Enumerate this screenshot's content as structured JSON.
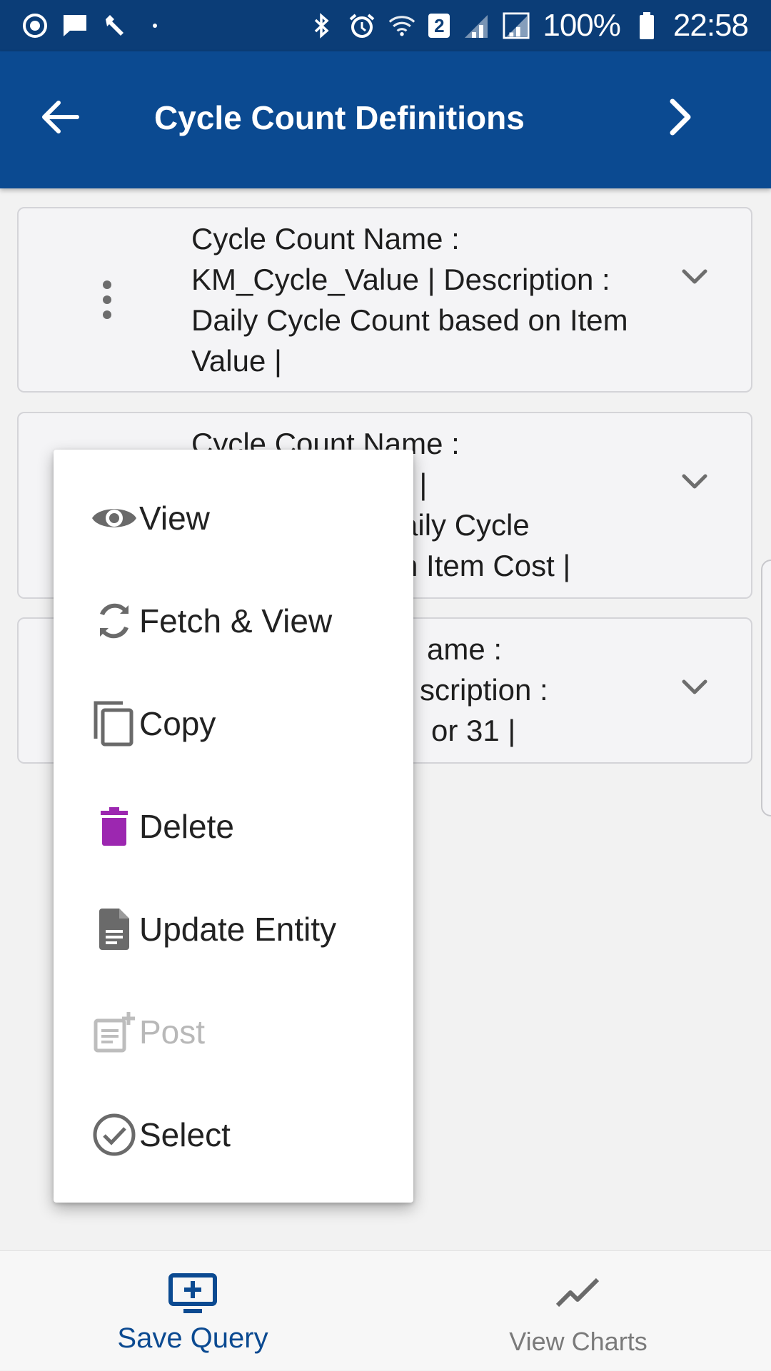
{
  "status_bar": {
    "battery": "100%",
    "time": "22:58",
    "sim_badge": "2",
    "icons_left": [
      "media-icon",
      "message-icon",
      "wrench-icon",
      "dot-icon"
    ],
    "icons_right": [
      "bluetooth-icon",
      "alarm-icon",
      "wifi-icon",
      "sim-icon",
      "signal-icon",
      "signal-icon",
      "battery-icon"
    ]
  },
  "app_bar": {
    "title": "Cycle Count Definitions",
    "back_icon": "arrow-back-icon",
    "forward_icon": "chevron-right-icon"
  },
  "cards": [
    {
      "text": "Cycle Count Name : KM_Cycle_Value | Description : Daily Cycle Count based on Item Value |"
    },
    {
      "text": "Cycle Count Name : KM_Cycle_Cost | Description : Daily Cycle Count based on Item Cost |"
    },
    {
      "text": "Cycle Count Name : KM_31 | Description : Cycle count for 31 |"
    }
  ],
  "visible_fragments": {
    "card2": [
      "Cycle Count Name :",
      "t |",
      "aily Cycle",
      "n Item Cost |"
    ],
    "card3": [
      "ame :",
      "scription :",
      "or 31 |"
    ]
  },
  "menu": {
    "items": [
      {
        "label": "View",
        "icon": "eye-icon",
        "enabled": true
      },
      {
        "label": "Fetch & View",
        "icon": "refresh-icon",
        "enabled": true
      },
      {
        "label": "Copy",
        "icon": "copy-icon",
        "enabled": true
      },
      {
        "label": "Delete",
        "icon": "trash-icon",
        "enabled": true
      },
      {
        "label": "Update Entity",
        "icon": "document-icon",
        "enabled": true
      },
      {
        "label": "Post",
        "icon": "post-icon",
        "enabled": false
      },
      {
        "label": "Select",
        "icon": "check-circle-icon",
        "enabled": true
      }
    ]
  },
  "bottom_nav": {
    "save_query": "Save Query",
    "view_charts": "View Charts"
  },
  "colors": {
    "app_bar": "#0b4a91",
    "status_bar": "#0b3d77",
    "delete_icon": "#9c27b0",
    "accent": "#0b4a91"
  }
}
